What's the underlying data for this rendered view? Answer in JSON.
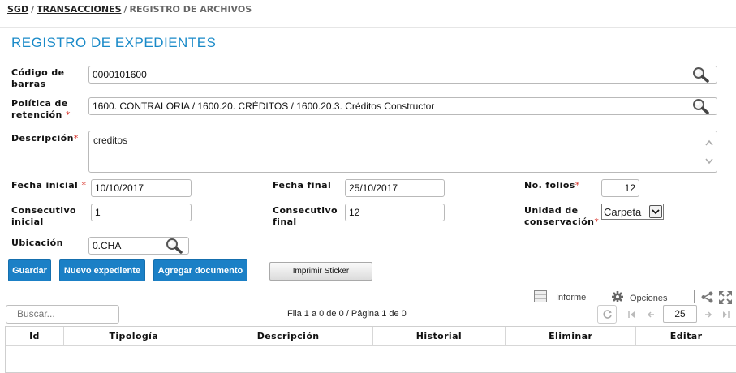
{
  "breadcrumb": {
    "root": "SGD",
    "section": "TRANSACCIONES",
    "current": "REGISTRO DE ARCHIVOS",
    "separator": "/"
  },
  "page": {
    "title": "REGISTRO DE EXPEDIENTES"
  },
  "form": {
    "barcode": {
      "label_1": "Código de",
      "label_2": "barras",
      "value": "0000101600"
    },
    "policy": {
      "label_1": "Política de",
      "label_2": "retención",
      "required_mark": "*",
      "value": "1600. CONTRALORIA / 1600.20. CRÉDITOS / 1600.20.3. Créditos Constructor"
    },
    "description": {
      "label": "Descripción",
      "required_mark": "*",
      "value": "creditos"
    },
    "start_date": {
      "label": "Fecha inicial",
      "required_mark": "*",
      "value": "10/10/2017"
    },
    "end_date": {
      "label": "Fecha final",
      "value": "25/10/2017"
    },
    "folios": {
      "label": "No. folios",
      "required_mark": "*",
      "value": "12"
    },
    "start_seq": {
      "label_1": "Consecutivo",
      "label_2": "inicial",
      "value": "1"
    },
    "end_seq": {
      "label_1": "Consecutivo",
      "label_2": "final",
      "value": "12"
    },
    "unit": {
      "label_1": "Unidad de",
      "label_2": "conservación",
      "required_mark": "*",
      "value": "Carpeta"
    },
    "location": {
      "label": "Ubicación",
      "value": "0.CHA"
    }
  },
  "actions": {
    "save": "Guardar",
    "new_file": "Nuevo expediente",
    "add_document": "Agregar documento",
    "print_sticker": "Imprimir Sticker"
  },
  "toolbar": {
    "report": "Informe",
    "options": "Opciones",
    "search_placeholder": "Buscar...",
    "pager_info": "Fila 1 a 0 de 0 / Página 1 de 0",
    "page_size": "25"
  },
  "grid": {
    "columns": [
      "Id",
      "Tipología",
      "Descripción",
      "Historial",
      "Eliminar",
      "Editar"
    ]
  },
  "colors": {
    "accent": "#1a8ac8",
    "button": "#1b80c6",
    "required": "#d9342b"
  }
}
